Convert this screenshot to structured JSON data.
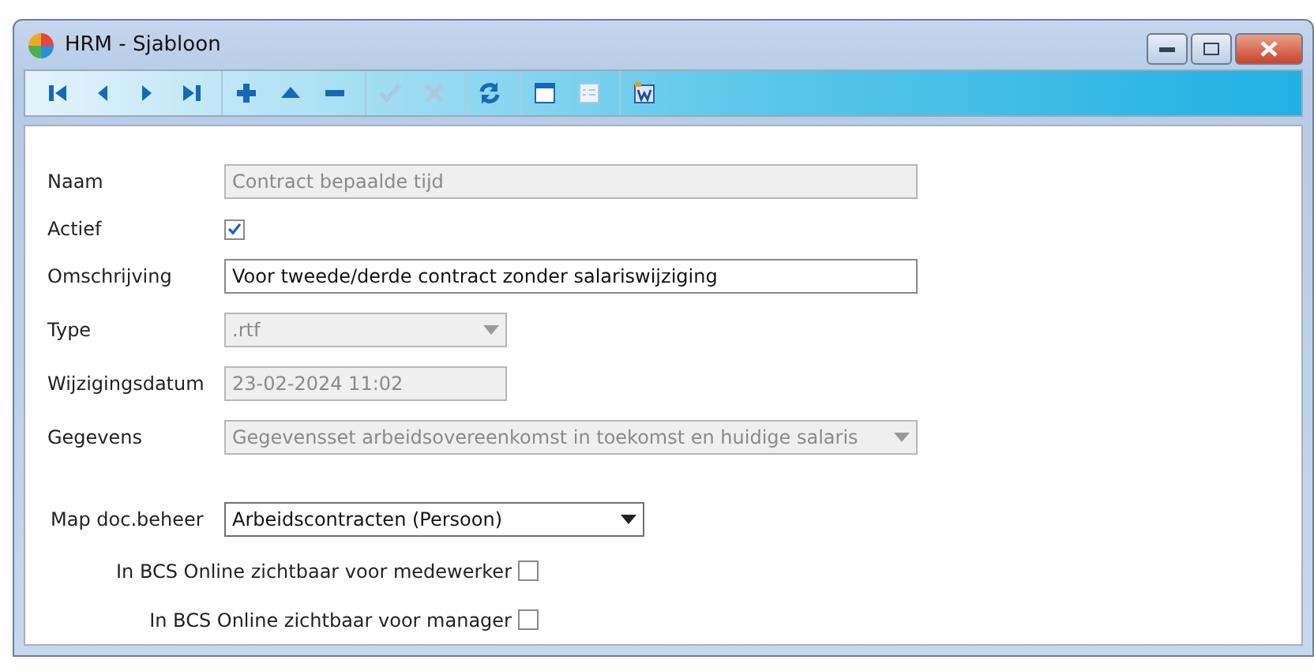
{
  "window": {
    "title": "HRM - Sjabloon"
  },
  "toolbar": {
    "groups": [
      [
        {
          "kind": "first",
          "disabled": false
        },
        {
          "kind": "prev",
          "disabled": false
        },
        {
          "kind": "next",
          "disabled": false
        },
        {
          "kind": "last",
          "disabled": false
        }
      ],
      [
        {
          "kind": "add",
          "disabled": false
        },
        {
          "kind": "up",
          "disabled": false
        },
        {
          "kind": "remove",
          "disabled": false
        }
      ],
      [
        {
          "kind": "confirm",
          "disabled": true
        },
        {
          "kind": "cancel",
          "disabled": true
        }
      ],
      [
        {
          "kind": "refresh",
          "disabled": false
        }
      ],
      [
        {
          "kind": "form-view",
          "disabled": false
        },
        {
          "kind": "list-view",
          "disabled": true
        }
      ],
      [
        {
          "kind": "word",
          "disabled": false
        }
      ]
    ]
  },
  "form": {
    "fields": [
      {
        "kind": "text",
        "label": "Naam",
        "value": "Contract bepaalde tijd",
        "disabled": true
      },
      {
        "kind": "checkbox",
        "label": "Actief",
        "checked": true
      },
      {
        "kind": "text",
        "label": "Omschrijving",
        "value": "Voor tweede/derde contract zonder salariswijziging",
        "disabled": false
      },
      {
        "kind": "select",
        "label": "Type",
        "value": ".rtf",
        "disabled": true
      },
      {
        "kind": "text",
        "label": "Wijzigingsdatum",
        "value": "23-02-2024 11:02",
        "disabled": true
      },
      {
        "kind": "select",
        "label": "Gegevens",
        "value": "Gegevensset arbeidsovereenkomst in toekomst en huidige salaris",
        "disabled": true
      }
    ],
    "map": {
      "label": "Map doc.beheer",
      "value": "Arbeidscontracten (Persoon)"
    },
    "sharing": [
      {
        "label": "In BCS Online zichtbaar voor medewerker",
        "checked": false
      },
      {
        "label": "In BCS Online zichtbaar voor manager",
        "checked": false
      }
    ]
  }
}
